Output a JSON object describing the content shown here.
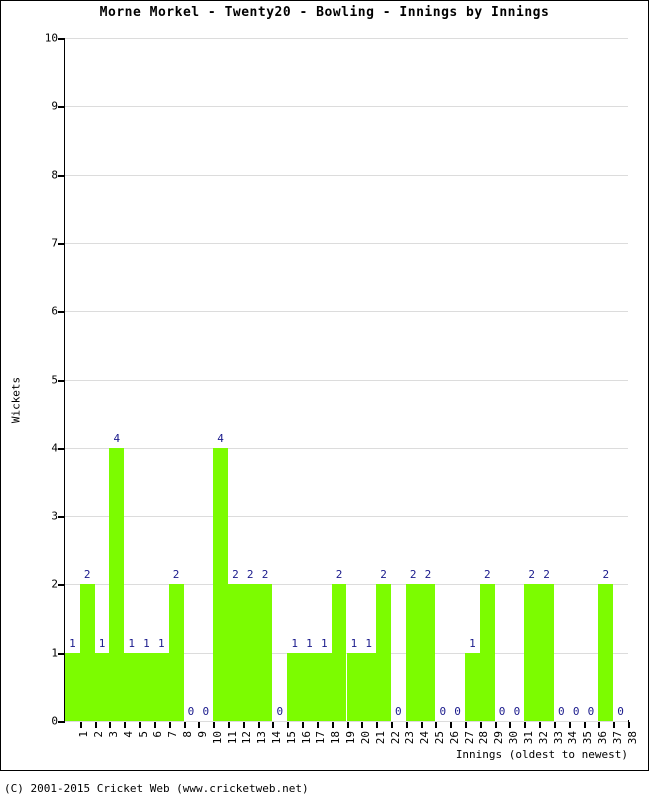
{
  "chart_data": {
    "type": "bar",
    "title": "Morne Morkel - Twenty20 - Bowling - Innings by Innings",
    "xlabel": "Innings (oldest to newest)",
    "ylabel": "Wickets",
    "ylim": [
      0,
      10
    ],
    "ytick_labels": [
      "0",
      "1",
      "2",
      "3",
      "4",
      "5",
      "6",
      "7",
      "8",
      "9",
      "10"
    ],
    "grid": true,
    "legend": null,
    "bar_color": "#7CFC00",
    "label_color": "#1a1a8c",
    "categories": [
      "1",
      "2",
      "3",
      "4",
      "5",
      "6",
      "7",
      "8",
      "9",
      "10",
      "11",
      "12",
      "13",
      "14",
      "15",
      "16",
      "17",
      "18",
      "19",
      "20",
      "21",
      "22",
      "23",
      "24",
      "25",
      "26",
      "27",
      "28",
      "29",
      "30",
      "31",
      "32",
      "33",
      "34",
      "35",
      "36",
      "37",
      "38"
    ],
    "values": [
      1,
      2,
      1,
      4,
      1,
      1,
      1,
      2,
      0,
      0,
      4,
      2,
      2,
      2,
      0,
      1,
      1,
      1,
      2,
      1,
      1,
      2,
      0,
      2,
      2,
      0,
      0,
      1,
      2,
      0,
      0,
      2,
      2,
      0,
      0,
      0,
      2,
      0
    ]
  },
  "footer": {
    "copyright": "(C) 2001-2015 Cricket Web (www.cricketweb.net)"
  }
}
